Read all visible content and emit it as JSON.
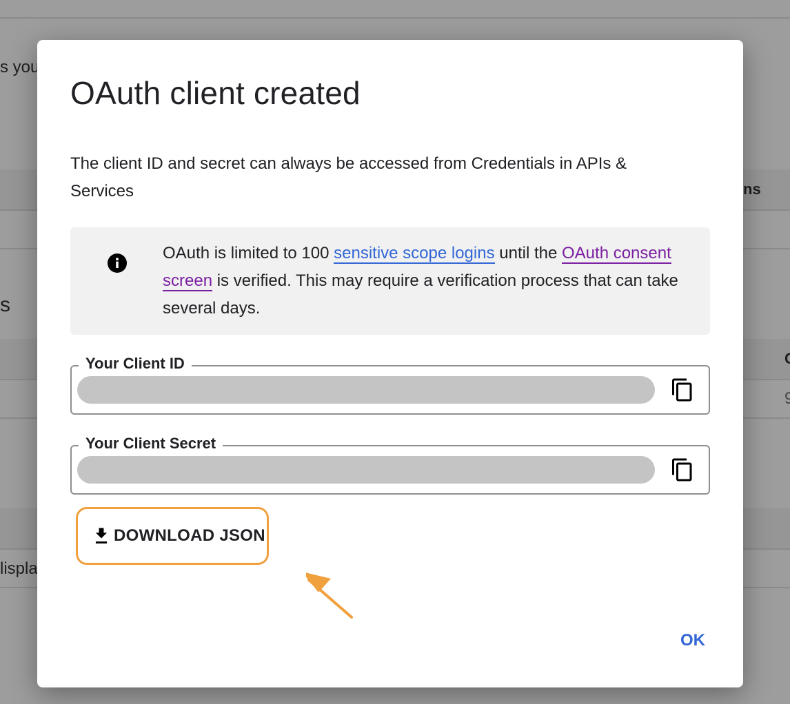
{
  "background": {
    "fragment_1": "s you",
    "fragment_2": "ns",
    "fragment_3": "s",
    "fragment_4": "C",
    "fragment_5": "9",
    "fragment_6": "lispla"
  },
  "dialog": {
    "title": "OAuth client created",
    "description": "The client ID and secret can always be accessed from Credentials in APIs & Services",
    "notice": {
      "icon": "info-icon",
      "text_before": "OAuth is limited to 100 ",
      "link_1": "sensitive scope logins",
      "text_middle": " until the ",
      "link_2": "OAuth consent screen",
      "text_after": " is verified. This may require a verification process that can take several days."
    },
    "client_id": {
      "label": "Your Client ID",
      "value": "",
      "copy_icon": "copy-icon"
    },
    "client_secret": {
      "label": "Your Client Secret",
      "value": "",
      "copy_icon": "copy-icon"
    },
    "download": {
      "icon": "download-icon",
      "label": "DOWNLOAD JSON",
      "highlight_color": "#f0a03c"
    },
    "ok_label": "OK"
  },
  "colors": {
    "link_blue": "#3367d6",
    "link_purple": "#7b1fa2",
    "highlight_orange": "#f0a03c",
    "overlay": "#9d9d9d"
  }
}
